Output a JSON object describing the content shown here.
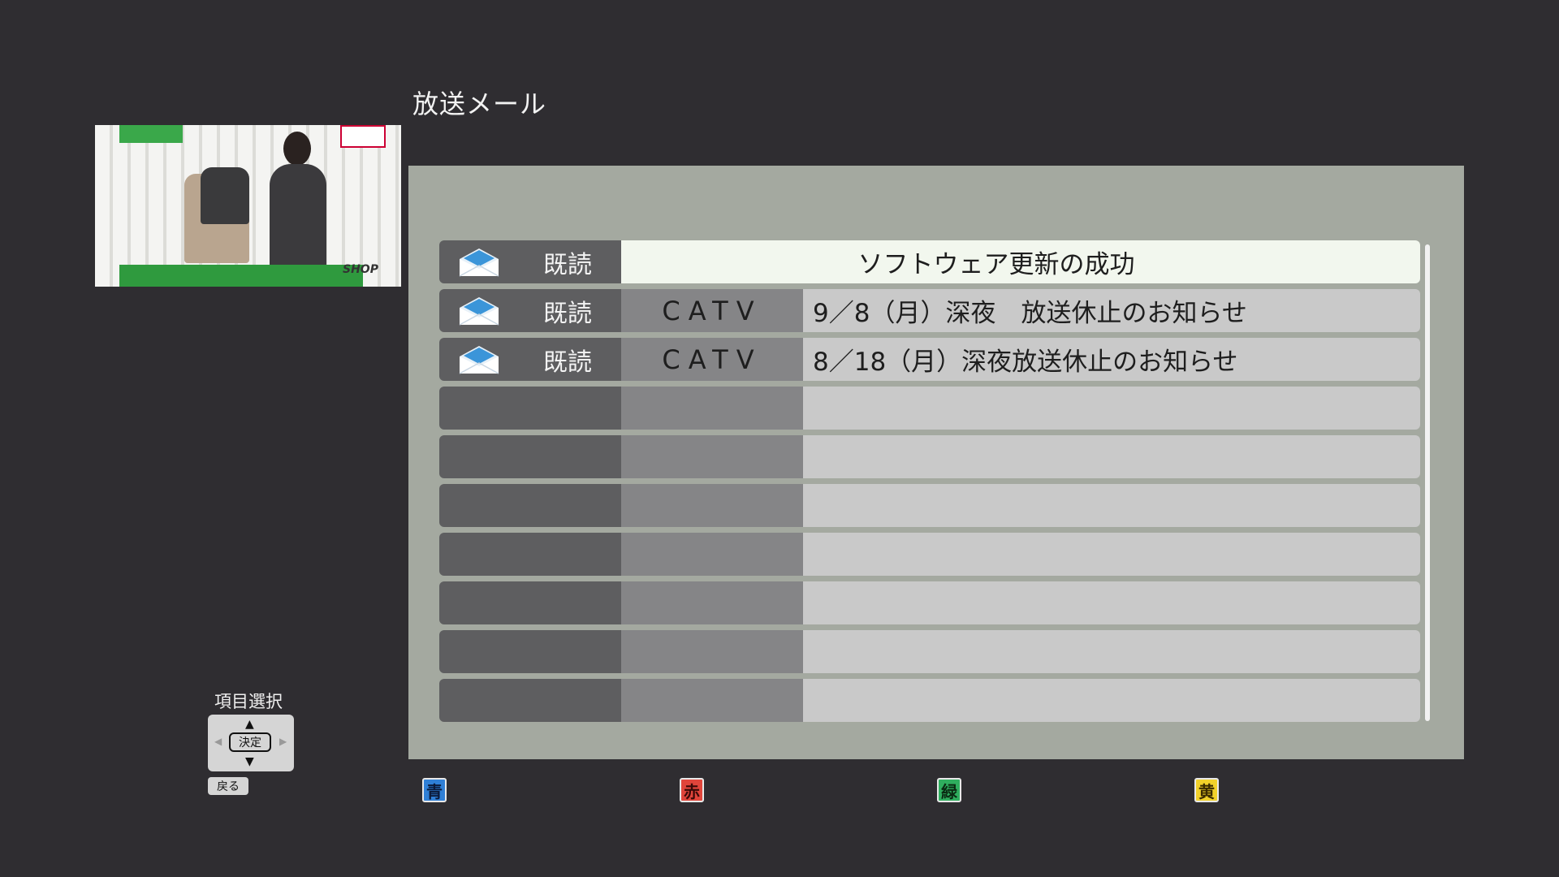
{
  "screen": {
    "title": "放送メール"
  },
  "preview": {
    "logo_text": "SHOP"
  },
  "mail_list": {
    "rows": [
      {
        "status": "既読",
        "sender": "",
        "subject": "ソフトウェア更新の成功",
        "icon": "envelope-open-icon",
        "selected": true
      },
      {
        "status": "既読",
        "sender": "CATV",
        "subject": "9／8（月）深夜　放送休止のお知らせ",
        "icon": "envelope-open-icon"
      },
      {
        "status": "既読",
        "sender": "CATV",
        "subject": "8／18（月）深夜放送休止のお知らせ",
        "icon": "envelope-open-icon"
      }
    ],
    "empty_rows": 7
  },
  "guide": {
    "label": "項目選択",
    "ok_label": "決定",
    "back_label": "戻る"
  },
  "color_keys": {
    "blue": "青",
    "red": "赤",
    "green": "緑",
    "yellow": "黄"
  },
  "colors": {
    "background": "#2f2d31",
    "panel": "#a4a9a0",
    "selected_row": "#f2f7ee",
    "blue": "#2f7fd6",
    "red": "#e0453b",
    "green": "#2fae5e",
    "yellow": "#f2d12a"
  }
}
